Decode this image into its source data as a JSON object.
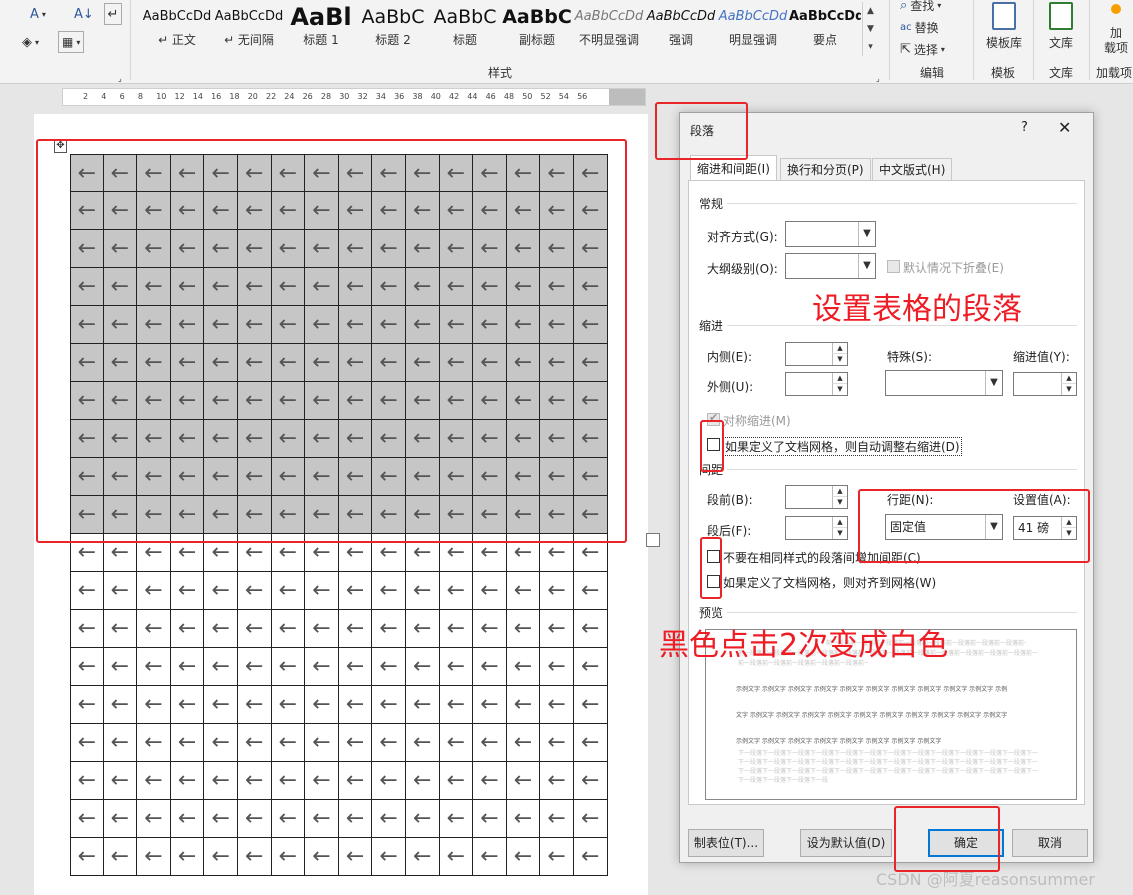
{
  "ribbon": {
    "styles": [
      {
        "sample": "AaBbCcDd",
        "name": "↵ 正文"
      },
      {
        "sample": "AaBbCcDd",
        "name": "↵ 无间隔"
      },
      {
        "sample": "AaBl",
        "name": "标题 1"
      },
      {
        "sample": "AaBbC",
        "name": "标题 2"
      },
      {
        "sample": "AaBbC",
        "name": "标题"
      },
      {
        "sample": "AaBbC",
        "name": "副标题"
      },
      {
        "sample": "AaBbCcDd",
        "name": "不明显强调"
      },
      {
        "sample": "AaBbCcDd",
        "name": "强调"
      },
      {
        "sample": "AaBbCcDd",
        "name": "明显强调"
      },
      {
        "sample": "AaBbCcDd",
        "name": "要点"
      }
    ],
    "styles_group_label": "样式",
    "editing": {
      "find": "查找",
      "replace": "替换",
      "select": "选择",
      "group_label": "编辑"
    },
    "template": {
      "button": "模板库",
      "group_label": "模板"
    },
    "library": {
      "button": "文库",
      "group_label": "文库"
    },
    "addins": {
      "button": "加\n载项",
      "group_label": "加载项"
    }
  },
  "ruler": {
    "ticks": [
      "2",
      "4",
      "6",
      "8",
      "10",
      "12",
      "14",
      "16",
      "18",
      "20",
      "22",
      "24",
      "26",
      "28",
      "30",
      "32",
      "34",
      "36",
      "38",
      "40",
      "42",
      "44",
      "46",
      "48",
      "50",
      "52",
      "54",
      "56"
    ]
  },
  "table": {
    "cell_glyph": "←",
    "rows": 19,
    "cols": 16,
    "selected_rows": 10
  },
  "dialog": {
    "title": "段落",
    "help": "?",
    "close": "✕",
    "tabs": [
      {
        "label": "缩进和间距(I)",
        "active": true
      },
      {
        "label": "换行和分页(P)",
        "active": false
      },
      {
        "label": "中文版式(H)",
        "active": false
      }
    ],
    "general": {
      "section": "常规",
      "alignment_label": "对齐方式(G):",
      "alignment_value": "",
      "outline_label": "大纲级别(O):",
      "outline_value": "",
      "collapsed_label": "默认情况下折叠(E)"
    },
    "indent": {
      "section": "缩进",
      "inside_label": "内侧(E):",
      "inside_value": "",
      "outside_label": "外侧(U):",
      "outside_value": "",
      "special_label": "特殊(S):",
      "special_value": "",
      "indent_by_label": "缩进值(Y):",
      "indent_by_value": "",
      "mirror_label": "对称缩进(M)",
      "auto_right_label": "如果定义了文档网格，则自动调整右缩进(D)"
    },
    "spacing": {
      "section": "间距",
      "before_label": "段前(B):",
      "before_value": "",
      "after_label": "段后(F):",
      "after_value": "",
      "line_spacing_label": "行距(N):",
      "line_spacing_value": "固定值",
      "at_label": "设置值(A):",
      "at_value": "41 磅",
      "no_space_label": "不要在相同样式的段落间增加间距(C)",
      "snap_grid_label": "如果定义了文档网格，则对齐到网格(W)"
    },
    "preview": {
      "section": "预览",
      "prev_text": "前一段落前一段落前一段落前一段落前一段落前一段落前一段落前一段落前一段落前一段落前一段落前一段落前一段落前一段落前一段落前一段落前一段落",
      "sample_line": "示例文字 示例文字 示例文字 示例文字 示例文字 示例文字 示例文字 示例文字 示例文字 示例文字 示例",
      "sample_line2": "文字 示例文字 示例文字 示例文字 示例文字 示例文字 示例文字 示例文字 示例文字 示例文字 示例文字",
      "sample_line3": "示例文字 示例文字 示例文字 示例文字 示例文字 示例文字 示例文字 示例文字",
      "next_text": "下一段落下一段落下一段落下一段落下一段落下一段落下一段落下一段落下一段落下一段落下一段落下一段落下一段落下一段落下一段落下一段落下一段落下一段落下一段落下一段落下一段落下一段落"
    },
    "buttons": {
      "tabs": "制表位(T)...",
      "set_default": "设为默认值(D)",
      "ok": "确定",
      "cancel": "取消"
    }
  },
  "annotations": {
    "set_table_paragraph": "设置表格的段落",
    "black_click_twice": "黑色点击2次变成白色",
    "color": "#e8262a"
  },
  "watermark": "CSDN @阿夏reasonsummer"
}
